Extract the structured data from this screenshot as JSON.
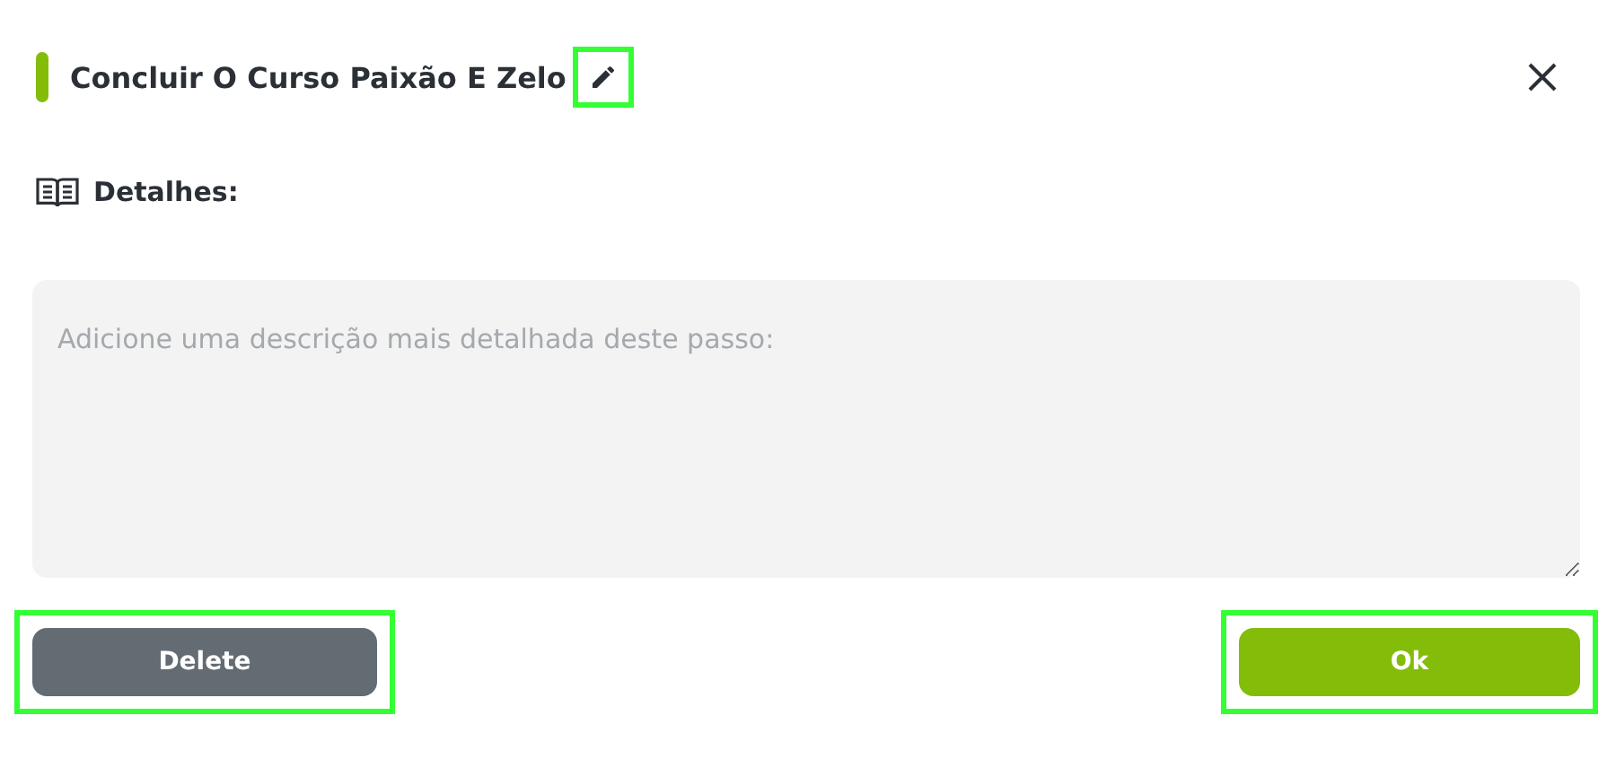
{
  "title": {
    "text": "Concluir O Curso Paixão E Zelo",
    "edit_highlighted": true
  },
  "details_label": "Detalhes:",
  "description": {
    "placeholder": "Adicione uma descrição mais detalhada deste passo:"
  },
  "buttons": [
    {
      "label": "Delete",
      "kind": "delete",
      "highlighted": true
    },
    {
      "label": "Ok",
      "kind": "ok",
      "highlighted": true
    }
  ]
}
